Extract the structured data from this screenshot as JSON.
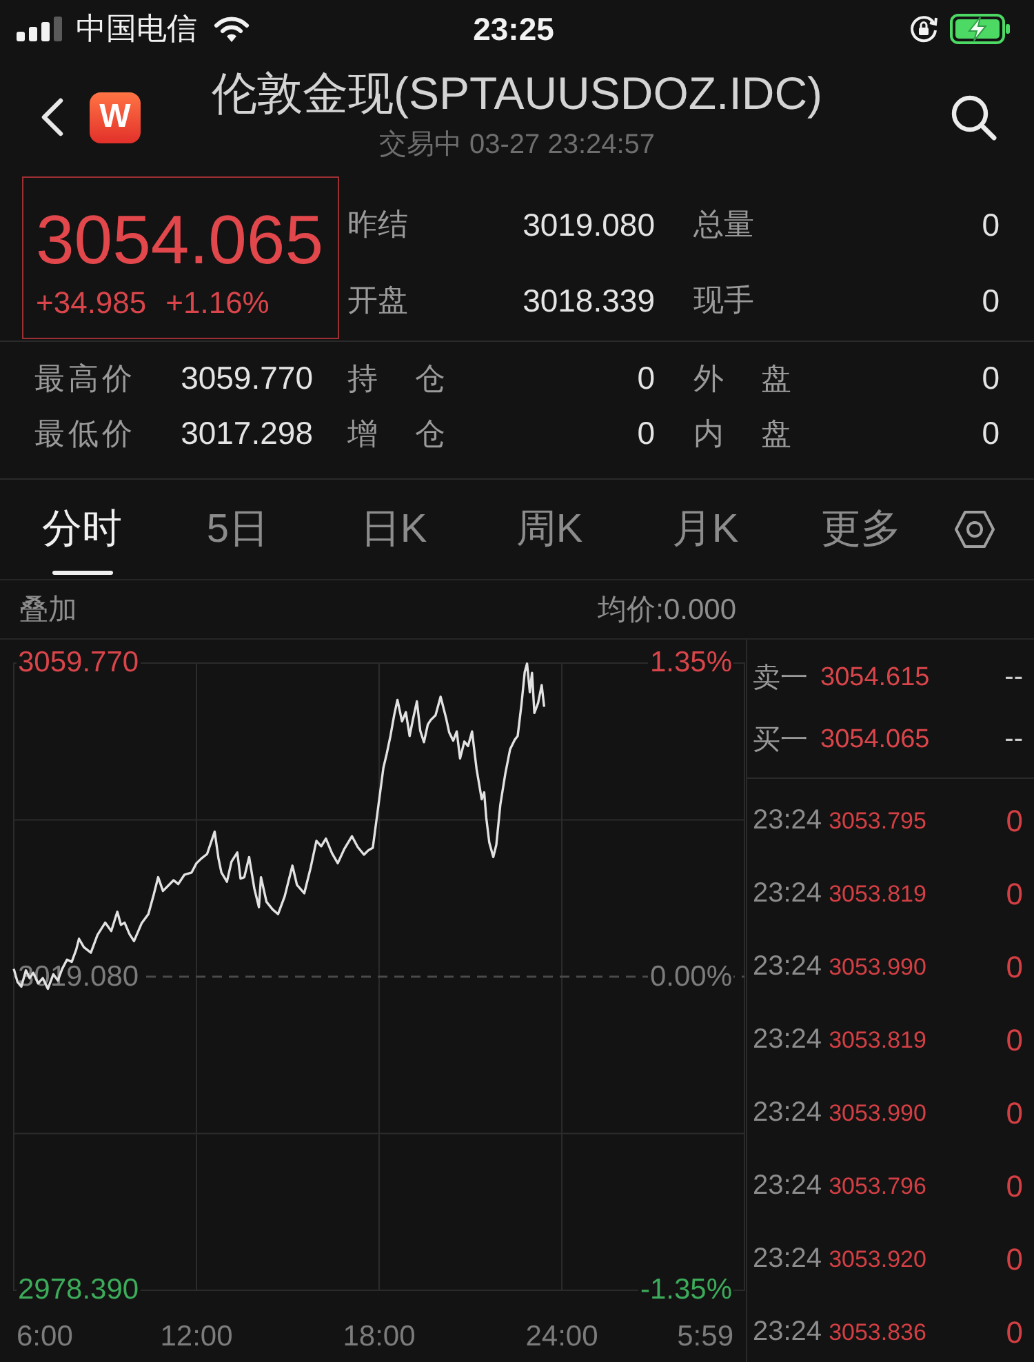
{
  "status_bar": {
    "carrier": "中国电信",
    "time": "23:25"
  },
  "header": {
    "logo": "W",
    "title": "伦敦金现(SPTAUUSDOZ.IDC)",
    "subtitle": "交易中 03-27 23:24:57"
  },
  "quote": {
    "price": "3054.065",
    "change": "+34.985",
    "change_percent": "+1.16%",
    "stats": [
      [
        {
          "label": "昨结",
          "value": "3019.080"
        },
        {
          "label": "总量",
          "value": "0"
        }
      ],
      [
        {
          "label": "开盘",
          "value": "3018.339"
        },
        {
          "label": "现手",
          "value": "0"
        }
      ]
    ],
    "details": [
      [
        {
          "label": "最高价",
          "value": "3059.770"
        },
        {
          "label": "持 仓",
          "value": "0"
        },
        {
          "label": "外 盘",
          "value": "0"
        }
      ],
      [
        {
          "label": "最低价",
          "value": "3017.298"
        },
        {
          "label": "增 仓",
          "value": "0"
        },
        {
          "label": "内 盘",
          "value": "0"
        }
      ]
    ]
  },
  "tabs": [
    {
      "label": "分时",
      "selected": true
    },
    {
      "label": "5日",
      "selected": false
    },
    {
      "label": "日K",
      "selected": false
    },
    {
      "label": "周K",
      "selected": false
    },
    {
      "label": "月K",
      "selected": false
    },
    {
      "label": "更多",
      "selected": false
    }
  ],
  "chart": {
    "overlay_button": "叠加",
    "average_price": "均价:0.000",
    "percent_labels": [
      "1.35%",
      "0.00%",
      "-1.35%"
    ],
    "session_close_label": "5:59",
    "chart_data": {
      "type": "line",
      "grid": true,
      "xlim": [
        6,
        30
      ],
      "ylim": [
        2978.39,
        3059.77
      ],
      "ref_lines": [
        {
          "axis": "y",
          "value": 3019.08
        }
      ],
      "xticks": [
        {
          "value": 6,
          "label": "6:00"
        },
        {
          "value": 12,
          "label": "12:00"
        },
        {
          "value": 18,
          "label": "18:00"
        },
        {
          "value": 24,
          "label": "24:00"
        }
      ],
      "yticks": [
        {
          "value": 3059.77,
          "label": "3059.770"
        },
        {
          "value": 3019.08,
          "label": "3019.080"
        },
        {
          "value": 2978.39,
          "label": "2978.390"
        }
      ],
      "x": [
        6,
        6.12,
        6.25,
        6.4,
        6.52,
        6.64,
        6.8,
        6.95,
        7.12,
        7.3,
        7.45,
        7.59,
        7.75,
        7.9,
        8.05,
        8.14,
        8.3,
        8.53,
        8.75,
        9,
        9.2,
        9.4,
        9.52,
        9.64,
        9.8,
        9.95,
        10.2,
        10.42,
        10.6,
        10.74,
        10.9,
        11.05,
        11.25,
        11.4,
        11.6,
        11.84,
        12,
        12.16,
        12.35,
        12.6,
        12.72,
        12.82,
        13,
        13.15,
        13.34,
        13.45,
        13.57,
        13.73,
        13.9,
        14.05,
        14.12,
        14.3,
        14.5,
        14.68,
        14.9,
        15.15,
        15.3,
        15.54,
        15.75,
        15.94,
        16.1,
        16.25,
        16.45,
        16.64,
        16.85,
        17.11,
        17.3,
        17.5,
        17.65,
        17.79,
        17.95,
        18.14,
        18.25,
        18.37,
        18.5,
        18.6,
        18.75,
        18.88,
        19,
        19.12,
        19.24,
        19.35,
        19.47,
        19.6,
        19.7,
        19.85,
        20.02,
        20.2,
        20.3,
        20.43,
        20.55,
        20.66,
        20.8,
        20.92,
        21.05,
        21.2,
        21.37,
        21.45,
        21.52,
        21.62,
        21.75,
        21.85,
        21.98,
        22.15,
        22.3,
        22.45,
        22.55,
        22.68,
        22.78,
        22.86,
        22.95,
        23.02,
        23.1,
        23.22,
        23.34,
        23.42
      ],
      "values": [
        3020.1,
        3018.4,
        3017.8,
        3019.9,
        3018.9,
        3019.6,
        3018.2,
        3018.9,
        3017.5,
        3019.4,
        3018.6,
        3020.1,
        3021.3,
        3021.0,
        3022.6,
        3024.0,
        3022.9,
        3022.2,
        3024.5,
        3026.1,
        3025.0,
        3027.5,
        3025.8,
        3026.1,
        3024.6,
        3023.7,
        3026.0,
        3027.2,
        3029.8,
        3032.0,
        3030.2,
        3030.8,
        3031.6,
        3031.1,
        3032.3,
        3032.6,
        3033.8,
        3034.4,
        3035.0,
        3037.9,
        3034.5,
        3032.6,
        3031.4,
        3034.0,
        3035.2,
        3031.8,
        3032.0,
        3034.6,
        3030.5,
        3028.1,
        3032.0,
        3028.8,
        3027.8,
        3027.2,
        3029.5,
        3033.5,
        3031.0,
        3029.9,
        3033.2,
        3036.7,
        3036.0,
        3037.0,
        3035.1,
        3033.8,
        3035.6,
        3037.3,
        3035.9,
        3034.9,
        3035.5,
        3035.8,
        3040.5,
        3046.2,
        3048.0,
        3050.3,
        3053.1,
        3055.0,
        3052.2,
        3053.4,
        3050.3,
        3052.6,
        3054.8,
        3051.0,
        3049.5,
        3051.8,
        3052.4,
        3053.0,
        3055.4,
        3052.6,
        3050.8,
        3049.7,
        3050.9,
        3047.4,
        3049.6,
        3049.0,
        3050.9,
        3046.0,
        3042.1,
        3043.0,
        3039.7,
        3036.5,
        3034.6,
        3036.2,
        3041.4,
        3045.5,
        3048.6,
        3049.8,
        3050.3,
        3054.5,
        3058.6,
        3059.7,
        3056.0,
        3058.5,
        3053.3,
        3054.6,
        3056.9,
        3054.1
      ]
    }
  },
  "order_book": {
    "quotes": [
      {
        "label": "卖一",
        "price": "3054.615",
        "volume": "--"
      },
      {
        "label": "买一",
        "price": "3054.065",
        "volume": "--"
      }
    ],
    "trades": [
      {
        "time": "23:24",
        "price": "3053.795",
        "volume": "0"
      },
      {
        "time": "23:24",
        "price": "3053.819",
        "volume": "0"
      },
      {
        "time": "23:24",
        "price": "3053.990",
        "volume": "0"
      },
      {
        "time": "23:24",
        "price": "3053.819",
        "volume": "0"
      },
      {
        "time": "23:24",
        "price": "3053.990",
        "volume": "0"
      },
      {
        "time": "23:24",
        "price": "3053.796",
        "volume": "0"
      },
      {
        "time": "23:24",
        "price": "3053.920",
        "volume": "0"
      },
      {
        "time": "23:24",
        "price": "3053.836",
        "volume": "0"
      }
    ]
  }
}
